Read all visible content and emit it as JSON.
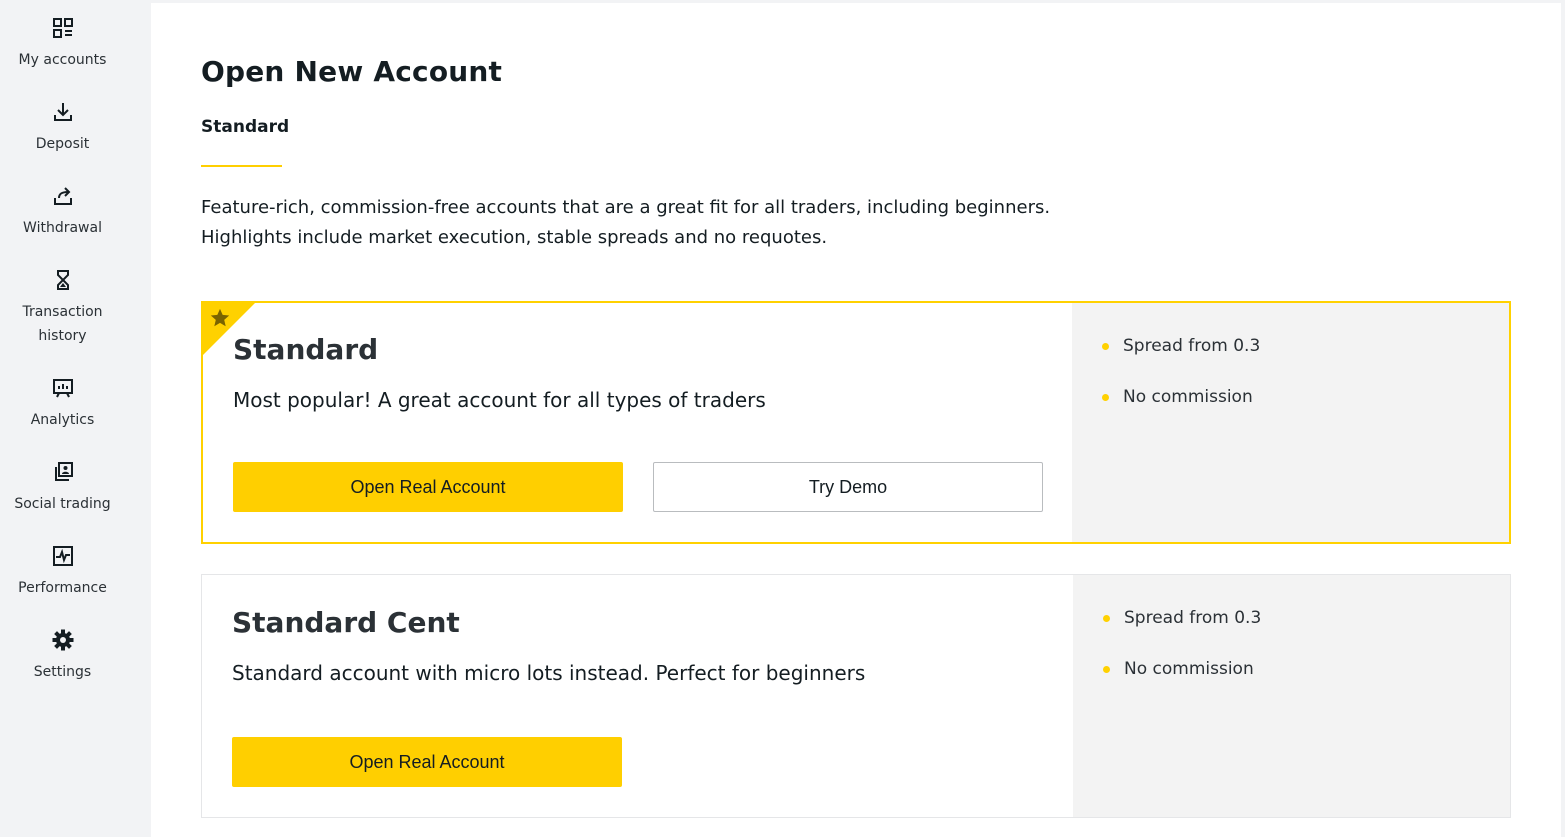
{
  "sidebar": {
    "items": [
      {
        "label": "My accounts",
        "icon": "accounts-grid-icon"
      },
      {
        "label": "Deposit",
        "icon": "download-icon"
      },
      {
        "label": "Withdrawal",
        "icon": "upload-share-icon"
      },
      {
        "label_line1": "Transaction",
        "label_line2": "history",
        "icon": "hourglass-icon"
      },
      {
        "label": "Analytics",
        "icon": "analytics-board-icon"
      },
      {
        "label": "Social trading",
        "icon": "social-trading-icon"
      },
      {
        "label": "Performance",
        "icon": "performance-chart-icon"
      },
      {
        "label": "Settings",
        "icon": "gear-icon"
      }
    ]
  },
  "main": {
    "title": "Open New Account",
    "tab": "Standard",
    "intro_line1": "Feature-rich, commission-free accounts that are a great fit for all traders, including beginners.",
    "intro_line2": "Highlights include market execution, stable spreads and no requotes."
  },
  "cards": [
    {
      "title": "Standard",
      "description": "Most popular! A great account for all types of traders",
      "featured": true,
      "primary_button": "Open Real Account",
      "secondary_button": "Try Demo",
      "features": [
        "Spread from 0.3",
        "No commission"
      ]
    },
    {
      "title": "Standard Cent",
      "description": "Standard account with micro lots instead. Perfect for beginners",
      "featured": false,
      "primary_button": "Open Real Account",
      "features": [
        "Spread from 0.3",
        "No commission"
      ]
    }
  ],
  "colors": {
    "accent": "#ffcf00",
    "sidebar_bg": "#f2f3f5",
    "text": "#141d22",
    "feature_panel_bg": "#f3f3f3"
  }
}
